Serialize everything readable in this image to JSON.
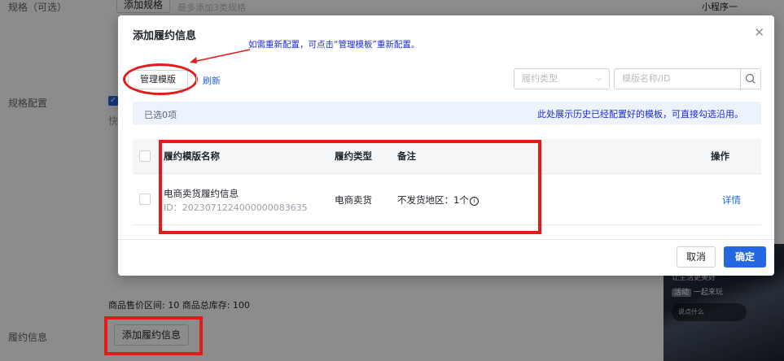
{
  "background": {
    "spec_label": "规格（可选）",
    "add_spec_button": "添加规格",
    "add_spec_hint": "最多添加3类规格",
    "spec_config_label": "规格配置",
    "quick_hint": "快",
    "price_range": "商品售价区间:  10    商品总库存:  100",
    "fulfillment_label": "履约信息",
    "add_fulfillment_button": "添加履约信息",
    "top_tab_1": "小程序一",
    "phone_line_1": "让生活更美好",
    "phone_line_2_tag": "活动",
    "phone_line_2": "一起来玩",
    "phone_input_placeholder": "说点什么"
  },
  "modal": {
    "title": "添加履约信息",
    "close_icon": "close-icon",
    "annotation": "如需重新配置，可点击“管理模板”重新配置。",
    "manage_template": "管理模版",
    "refresh": "刷新",
    "type_select_placeholder": "履约类型",
    "search_placeholder": "模版名称/ID",
    "selected_count": "已选0项",
    "info_note": "此处展示历史已经配置好的模板，可直接勾选沿用。",
    "table": {
      "columns": [
        "履约模版名称",
        "履约类型",
        "备注",
        "操作"
      ],
      "rows": [
        {
          "name": "电商卖货履约信息",
          "id": "ID：2023071224000000083635",
          "type": "电商卖货",
          "remark": "不发货地区：1个",
          "action": "详情"
        }
      ]
    },
    "cancel": "取消",
    "confirm": "确定"
  },
  "colors": {
    "primary": "#2467e0",
    "annotation_red": "#e31b1b",
    "annotation_blue": "#1b2bd6"
  }
}
